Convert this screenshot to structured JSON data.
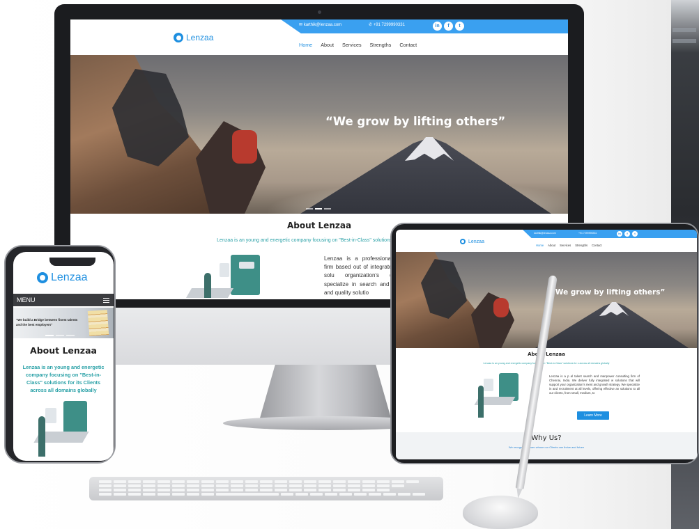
{
  "brand": {
    "name": "Lenzaa"
  },
  "topbar": {
    "email": "karthik@lenzaa.com",
    "phone": "+91 7299990331",
    "social": [
      "in",
      "f",
      "t"
    ]
  },
  "nav": {
    "items": [
      "Home",
      "About",
      "Services",
      "Strengths",
      "Contact"
    ],
    "active": "Home"
  },
  "hero": {
    "quote": "“We grow by lifting others”"
  },
  "about": {
    "title": "About Lenzaa",
    "subtitle": "Lenzaa is an young and energetic company focusing on \"Best-in-Class\" solutions for its Clients",
    "monitor_paragraph": "Lenzaa is a professional consulting firm based out of integrated workforce solu organization’s development specialize in search and re effective and quality solutio",
    "tablet_paragraph": "Lenzaa is a p al talent search and manpower consulting firm of Chennai, India. We deliver fully integrated w solutions that will support your organization’s ment and growth strategy. We specialize in and recruitment at all levels, offering effective an solutions to all our clients, from small, medium, to",
    "tablet_subtitle": "Lenzaa is an young and energetic company focusing on \"Best-in-Class\" solutions for s across all domains globally",
    "learn_more": "Learn More"
  },
  "why": {
    "title": "Why Us?",
    "subtitle": "We recognize a team whose our Clients can thrive and future"
  },
  "mobile": {
    "menu_label": "MENU",
    "banner_text": "\"We build a Bridge between finest talents and the best employers\"",
    "about_title": "About Lenzaa",
    "about_subtitle": "Lenzaa is an young and energetic company focusing on \"Best-in-Class\" solutions for its Clients across all domains globally"
  },
  "colors": {
    "accent": "#1e8fe0",
    "topbar": "#3aa0f0",
    "teal_text": "#2aa1a7",
    "dark_menu": "#3b3c40"
  }
}
